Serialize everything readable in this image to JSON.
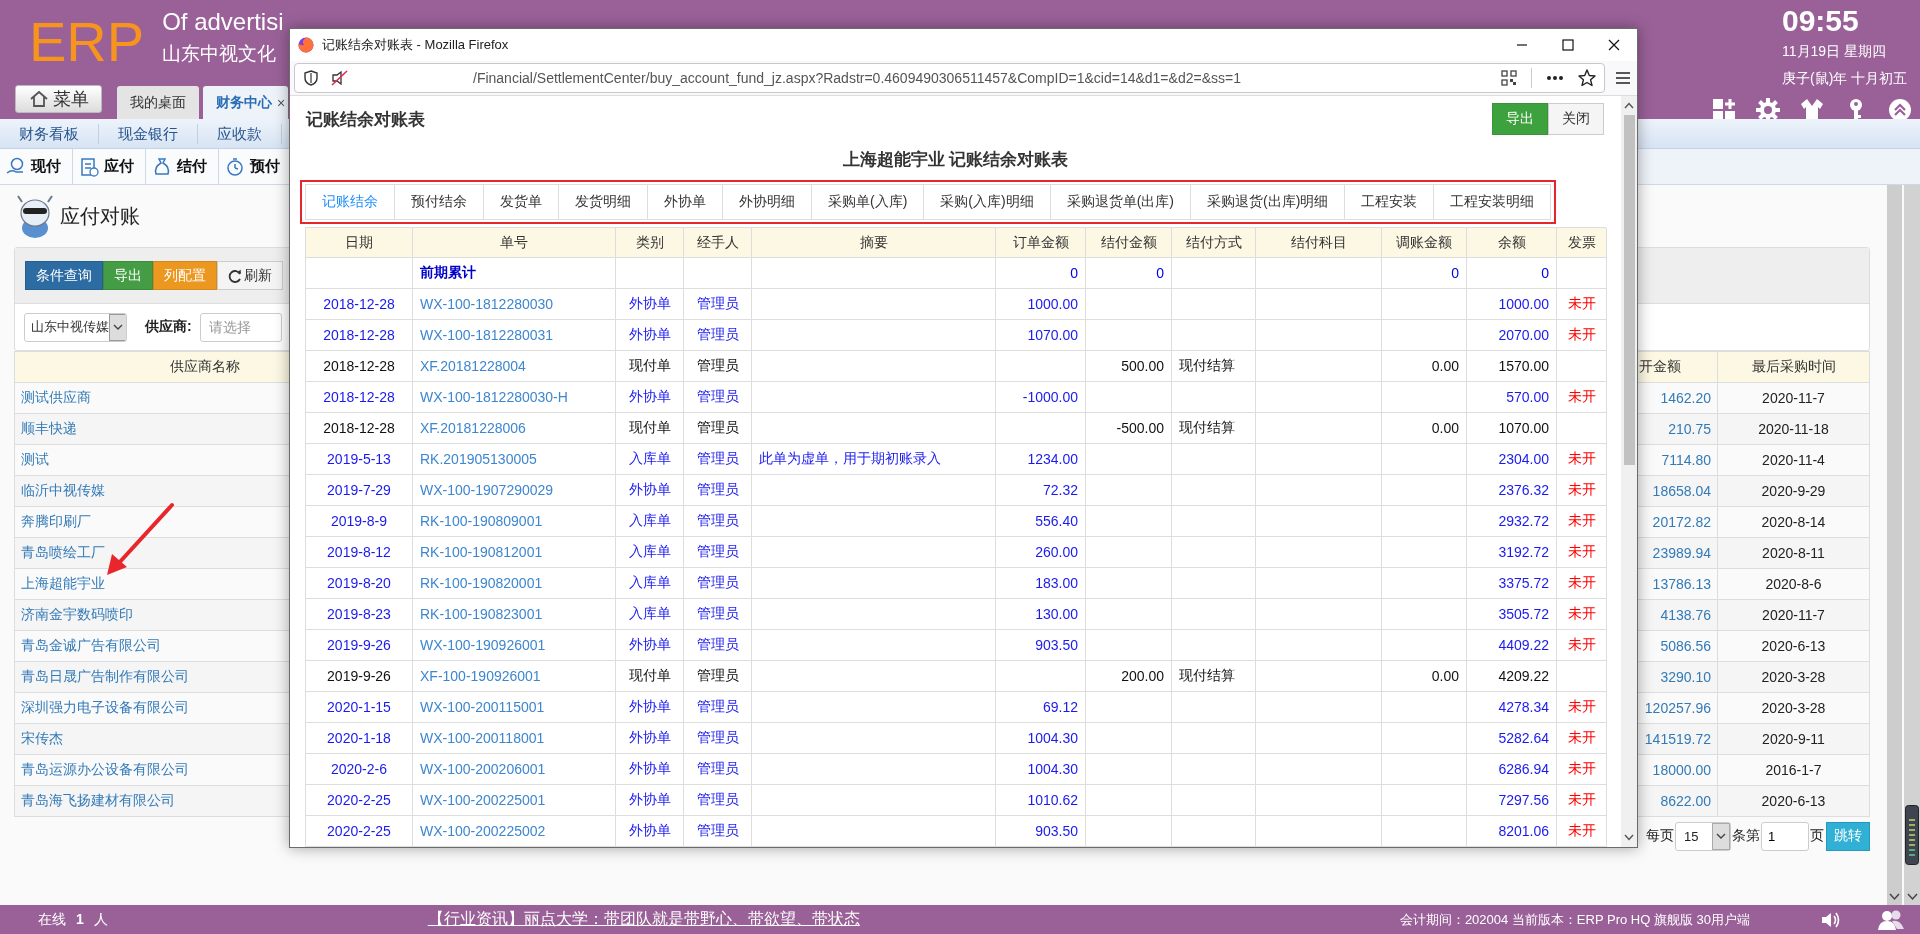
{
  "header": {
    "logo": "ERP",
    "tagline": "Of advertisi",
    "company": "山东中视文化",
    "time": "09:55",
    "date": "11月19日 星期四",
    "lunar_date": "庚子(鼠)年 十月初五"
  },
  "menu_button": "菜单",
  "tabs": [
    {
      "label": "我的桌面",
      "selected": false
    },
    {
      "label": "财务中心",
      "selected": true,
      "close": "×"
    }
  ],
  "section_nav": [
    "财务看板",
    "现金银行",
    "应收款"
  ],
  "module_nav": [
    "现付",
    "应付",
    "结付",
    "预付"
  ],
  "page": {
    "title": "应付对账",
    "toolbar": [
      {
        "label": "条件查询",
        "kind": "primary"
      },
      {
        "label": "导出",
        "kind": "success"
      },
      {
        "label": "列配置",
        "kind": "warning"
      },
      {
        "label": "刷新",
        "kind": "refresh"
      }
    ],
    "company_select": "山东中视传媒",
    "supplier_label": "供应商:",
    "supplier_placeholder": "请选择",
    "table": {
      "columns": [
        "供应商名称",
        "开金额",
        "最后采购时间"
      ],
      "rows": [
        {
          "name": "测试供应商",
          "amount": "1462.20",
          "last_purchase": "2020-11-7"
        },
        {
          "name": "顺丰快递",
          "amount": "210.75",
          "last_purchase": "2020-11-18"
        },
        {
          "name": "测试",
          "amount": "7114.80",
          "last_purchase": "2020-11-4"
        },
        {
          "name": "临沂中视传媒",
          "amount": "18658.04",
          "last_purchase": "2020-9-29"
        },
        {
          "name": "奔腾印刷厂",
          "amount": "20172.82",
          "last_purchase": "2020-8-14"
        },
        {
          "name": "青岛喷绘工厂",
          "amount": "23989.94",
          "last_purchase": "2020-8-11"
        },
        {
          "name": "上海超能宇业",
          "amount": "13786.13",
          "last_purchase": "2020-8-6"
        },
        {
          "name": "济南金宇数码喷印",
          "amount": "4138.76",
          "last_purchase": "2020-11-7"
        },
        {
          "name": "青岛金诚广告有限公司",
          "amount": "5086.56",
          "last_purchase": "2020-6-13"
        },
        {
          "name": "青岛日晟广告制作有限公司",
          "amount": "3290.10",
          "last_purchase": "2020-3-28"
        },
        {
          "name": "深圳强力电子设备有限公司",
          "amount": "120257.96",
          "last_purchase": "2020-3-28"
        },
        {
          "name": "宋传杰",
          "amount": "141519.72",
          "last_purchase": "2020-9-11"
        },
        {
          "name": "青岛运源办公设备有限公司",
          "amount": "18000.00",
          "last_purchase": "2016-1-7"
        },
        {
          "name": "青岛海飞扬建材有限公司",
          "amount": "8622.00",
          "last_purchase": "2020-6-13"
        }
      ]
    },
    "pagination": {
      "per_page_label": "每页",
      "per_page": "15",
      "page_label": "条第",
      "page": "1",
      "page_suffix": "页",
      "go_button": "跳转"
    }
  },
  "popup": {
    "title": "记账结余对账表 - Mozilla Firefox",
    "url": "/Financial/SettlementCenter/buy_account_fund_jz.aspx?Radstr=0.4609490306511457&CompID=1&cid=14&d1=&d2=&ss=1",
    "page_title": "记账结余对账表",
    "buttons": [
      {
        "label": "导出",
        "kind": "success"
      },
      {
        "label": "关闭",
        "kind": "default"
      }
    ],
    "heading": "上海超能宇业 记账结余对账表",
    "tabs": [
      {
        "label": "记账结余",
        "selected": true
      },
      {
        "label": "预付结余",
        "selected": false
      },
      {
        "label": "发货单",
        "selected": false
      },
      {
        "label": "发货明细",
        "selected": false
      },
      {
        "label": "外协单",
        "selected": false
      },
      {
        "label": "外协明细",
        "selected": false
      },
      {
        "label": "采购单(入库)",
        "selected": false
      },
      {
        "label": "采购(入库)明细",
        "selected": false
      },
      {
        "label": "采购退货单(出库)",
        "selected": false
      },
      {
        "label": "采购退货(出库)明细",
        "selected": false
      },
      {
        "label": "工程安装",
        "selected": false
      },
      {
        "label": "工程安装明细",
        "selected": false
      }
    ],
    "table": {
      "columns": [
        "日期",
        "单号",
        "类别",
        "经手人",
        "摘要",
        "订单金额",
        "结付金额",
        "结付方式",
        "结付科目",
        "调账金额",
        "余额",
        "发票"
      ],
      "rows": [
        {
          "kind": "opening",
          "number": "前期累计",
          "order_amount": "0",
          "paid_amount": "0",
          "adjust_amount": "0",
          "balance": "0"
        },
        {
          "kind": "order",
          "date": "2018-12-28",
          "number": "WX-100-1812280030",
          "type": "外协单",
          "handler": "管理员",
          "order_amount": "1000.00",
          "balance": "1000.00",
          "invoice": "未开"
        },
        {
          "kind": "order",
          "date": "2018-12-28",
          "number": "WX-100-1812280031",
          "type": "外协单",
          "handler": "管理员",
          "order_amount": "1070.00",
          "balance": "2070.00",
          "invoice": "未开"
        },
        {
          "kind": "cash",
          "date": "2018-12-28",
          "number": "XF.20181228004",
          "type": "现付单",
          "handler": "管理员",
          "paid_amount": "500.00",
          "pay_method": "现付结算",
          "adjust_amount": "0.00",
          "balance": "1570.00"
        },
        {
          "kind": "order",
          "date": "2018-12-28",
          "number": "WX-100-1812280030-H",
          "type": "外协单",
          "handler": "管理员",
          "order_amount": "-1000.00",
          "balance": "570.00",
          "invoice": "未开"
        },
        {
          "kind": "cash",
          "date": "2018-12-28",
          "number": "XF.20181228006",
          "type": "现付单",
          "handler": "管理员",
          "paid_amount": "-500.00",
          "pay_method": "现付结算",
          "adjust_amount": "0.00",
          "balance": "1070.00"
        },
        {
          "kind": "order",
          "date": "2019-5-13",
          "number": "RK.201905130005",
          "type": "入库单",
          "handler": "管理员",
          "summary": "此单为虚单，用于期初账录入",
          "order_amount": "1234.00",
          "balance": "2304.00",
          "invoice": "未开"
        },
        {
          "kind": "order",
          "date": "2019-7-29",
          "number": "WX-100-1907290029",
          "type": "外协单",
          "handler": "管理员",
          "order_amount": "72.32",
          "balance": "2376.32",
          "invoice": "未开"
        },
        {
          "kind": "order",
          "date": "2019-8-9",
          "number": "RK-100-190809001",
          "type": "入库单",
          "handler": "管理员",
          "order_amount": "556.40",
          "balance": "2932.72",
          "invoice": "未开"
        },
        {
          "kind": "order",
          "date": "2019-8-12",
          "number": "RK-100-190812001",
          "type": "入库单",
          "handler": "管理员",
          "order_amount": "260.00",
          "balance": "3192.72",
          "invoice": "未开"
        },
        {
          "kind": "order",
          "date": "2019-8-20",
          "number": "RK-100-190820001",
          "type": "入库单",
          "handler": "管理员",
          "order_amount": "183.00",
          "balance": "3375.72",
          "invoice": "未开"
        },
        {
          "kind": "order",
          "date": "2019-8-23",
          "number": "RK-100-190823001",
          "type": "入库单",
          "handler": "管理员",
          "order_amount": "130.00",
          "balance": "3505.72",
          "invoice": "未开"
        },
        {
          "kind": "order",
          "date": "2019-9-26",
          "number": "WX-100-190926001",
          "type": "外协单",
          "handler": "管理员",
          "order_amount": "903.50",
          "balance": "4409.22",
          "invoice": "未开"
        },
        {
          "kind": "cash",
          "date": "2019-9-26",
          "number": "XF-100-190926001",
          "type": "现付单",
          "handler": "管理员",
          "paid_amount": "200.00",
          "pay_method": "现付结算",
          "adjust_amount": "0.00",
          "balance": "4209.22"
        },
        {
          "kind": "order",
          "date": "2020-1-15",
          "number": "WX-100-200115001",
          "type": "外协单",
          "handler": "管理员",
          "order_amount": "69.12",
          "balance": "4278.34",
          "invoice": "未开"
        },
        {
          "kind": "order",
          "date": "2020-1-18",
          "number": "WX-100-200118001",
          "type": "外协单",
          "handler": "管理员",
          "order_amount": "1004.30",
          "balance": "5282.64",
          "invoice": "未开"
        },
        {
          "kind": "order",
          "date": "2020-2-6",
          "number": "WX-100-200206001",
          "type": "外协单",
          "handler": "管理员",
          "order_amount": "1004.30",
          "balance": "6286.94",
          "invoice": "未开"
        },
        {
          "kind": "order",
          "date": "2020-2-25",
          "number": "WX-100-200225001",
          "type": "外协单",
          "handler": "管理员",
          "order_amount": "1010.62",
          "balance": "7297.56",
          "invoice": "未开"
        },
        {
          "kind": "order",
          "date": "2020-2-25",
          "number": "WX-100-200225002",
          "type": "外协单",
          "handler": "管理员",
          "order_amount": "903.50",
          "balance": "8201.06",
          "invoice": "未开"
        }
      ]
    }
  },
  "status_bar": {
    "online_label": "在线",
    "online_count": "1",
    "online_unit": "人",
    "news": "【行业资讯】丽点大学：带团队就是带野心、带欲望、带状态",
    "info": "会计期间：202004 当前版本：ERP Pro HQ 旗舰版 30用户端"
  }
}
